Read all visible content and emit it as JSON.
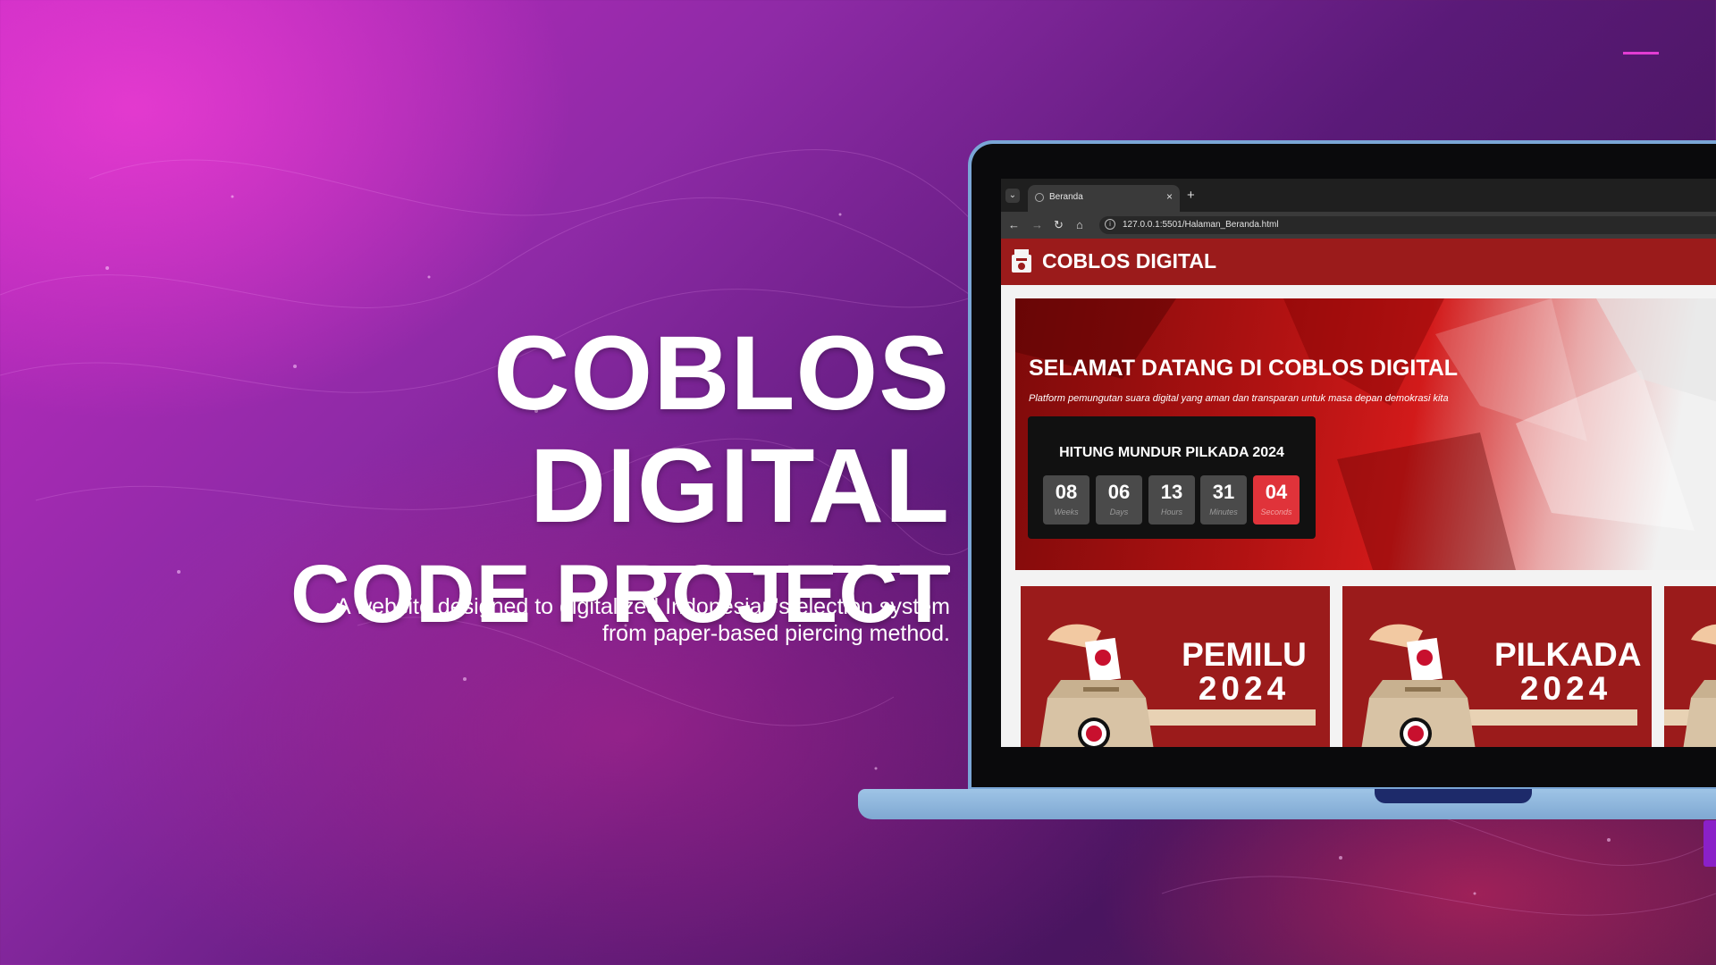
{
  "hero": {
    "title": "COBLOS DIGITAL",
    "subtitle": "CODE PROJECT",
    "tagline_line1": "A website designed to digitalized Indonesian's election system",
    "tagline_line2": "from paper-based piercing method."
  },
  "browser": {
    "tab_title": "Beranda",
    "tab_close": "×",
    "new_tab": "+",
    "url": "127.0.0.1:5501/Halaman_Beranda.html",
    "icons": [
      "chevron-down-icon",
      "globe-icon",
      "close-icon",
      "plus-icon",
      "back-arrow-icon",
      "forward-arrow-icon",
      "reload-icon",
      "home-icon",
      "info-icon"
    ]
  },
  "site": {
    "title": "COBLOS DIGITAL",
    "welcome": "SELAMAT DATANG DI COBLOS DIGITAL",
    "subtitle": "Platform pemungutan suara digital yang aman dan transparan untuk masa depan demokrasi kita",
    "countdown": {
      "title": "HITUNG MUNDUR PILKADA 2024",
      "units": [
        {
          "value": "08",
          "label": "Weeks"
        },
        {
          "value": "06",
          "label": "Days"
        },
        {
          "value": "13",
          "label": "Hours"
        },
        {
          "value": "31",
          "label": "Minutes"
        },
        {
          "value": "04",
          "label": "Seconds"
        }
      ]
    },
    "cards": [
      {
        "line1": "PEMILU",
        "line2": "2024"
      },
      {
        "line1": "PILKADA",
        "line2": "2024"
      }
    ]
  },
  "colors": {
    "site_red": "#9b1b1b",
    "highlight_red": "#e0333a",
    "laptop_frame": "#7aa6d6"
  }
}
